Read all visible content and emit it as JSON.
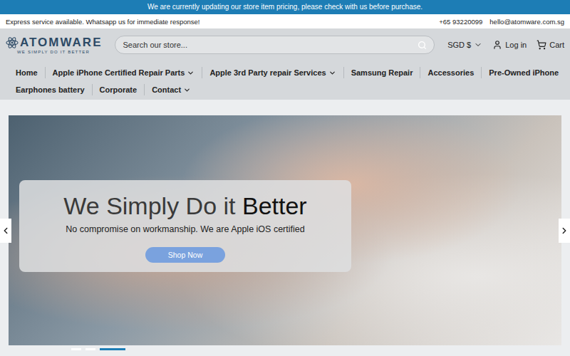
{
  "announcement": "We are currently updating our store item pricing, please check with us before purchase.",
  "topbar": {
    "notice": "Express service available. Whatsapp us for immediate response!",
    "phone": "+65 93220099",
    "email": "hello@atomware.com.sg"
  },
  "logo": {
    "name": "ATOMWARE",
    "tagline": "WE SIMPLY DO IT BETTER"
  },
  "search": {
    "placeholder": "Search our store..."
  },
  "currency": {
    "label": "SGD $"
  },
  "account": {
    "label": "Log in"
  },
  "cart": {
    "label": "Cart"
  },
  "nav_rows": [
    [
      {
        "label": "Home",
        "dropdown": false
      },
      {
        "label": "Apple iPhone Certified Repair Parts",
        "dropdown": true
      },
      {
        "label": "Apple 3rd Party repair Services",
        "dropdown": true
      },
      {
        "label": "Samsung Repair",
        "dropdown": false
      },
      {
        "label": "Accessories",
        "dropdown": false
      },
      {
        "label": "Pre-Owned iPhone",
        "dropdown": false
      }
    ],
    [
      {
        "label": "Earphones battery",
        "dropdown": false
      },
      {
        "label": "Corporate",
        "dropdown": false
      },
      {
        "label": "Contact",
        "dropdown": true
      }
    ]
  ],
  "hero": {
    "title": "We Simply Do it",
    "title_emphasis": "Better",
    "subtitle": "No compromise on workmanship. We are Apple iOS certified",
    "button": "Shop Now"
  },
  "slides": [
    {
      "selected": false
    },
    {
      "selected": false
    },
    {
      "selected": true
    }
  ]
}
